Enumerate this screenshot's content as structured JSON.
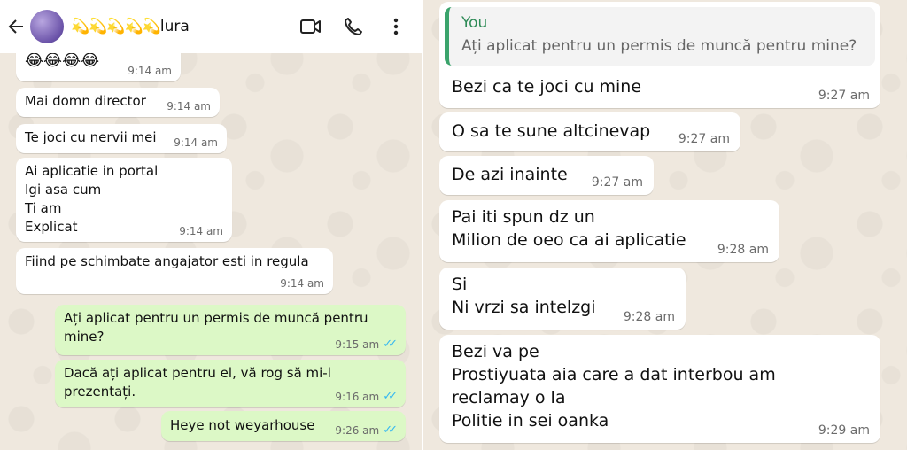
{
  "header": {
    "contact_emoji": "💫💫💫💫💫",
    "contact_name": "lura",
    "back_icon": "back-arrow-icon",
    "video_icon": "video-call-icon",
    "call_icon": "phone-icon",
    "menu_icon": "more-vert-icon"
  },
  "colors": {
    "incoming": "#ffffff",
    "outgoing": "#dcf8c6",
    "read_ticks": "#34b7f1",
    "quote_accent": "#3aa36b"
  },
  "left_messages": [
    {
      "text": "😂😂😂😂",
      "time": "9:14 am"
    },
    {
      "text": "Mai domn director",
      "time": "9:14 am"
    },
    {
      "text": "Te joci cu nervii mei",
      "time": "9:14 am"
    },
    {
      "text": "Ai aplicatie in portal\nIgi asa cum\nTi am\nExplicat",
      "time": "9:14 am"
    },
    {
      "text": "Fiind pe schimbate angajator esti in regula",
      "time": "9:14 am"
    },
    {
      "text": "Ați aplicat pentru un permis de muncă pentru\nmine?",
      "time": "9:15 am"
    },
    {
      "text": "Dacă ați aplicat pentru el, vă rog să mi-l\nprezentați.",
      "time": "9:16 am"
    },
    {
      "text": "Heye not weyarhouse",
      "time": "9:26 am"
    }
  ],
  "right_messages": {
    "quote": {
      "author": "You",
      "text": "Ați aplicat pentru un permis de muncă pentru mine?"
    },
    "items": [
      {
        "text": "Bezi ca te joci cu mine",
        "time": "9:27 am"
      },
      {
        "text": "O sa te sune altcinevap",
        "time": "9:27 am"
      },
      {
        "text": "De azi inainte",
        "time": "9:27 am"
      },
      {
        "text": "Pai iti spun dz un\nMilion de oeo ca ai aplicatie",
        "time": "9:28 am"
      },
      {
        "text": "Si\nNi vrzi sa intelzgi",
        "time": "9:28 am"
      },
      {
        "text": "Bezi va pe\nProstiyuata aia care a dat interbou am\nreclamay o la\nPolitie in sei oanka",
        "time": "9:29 am"
      }
    ]
  }
}
